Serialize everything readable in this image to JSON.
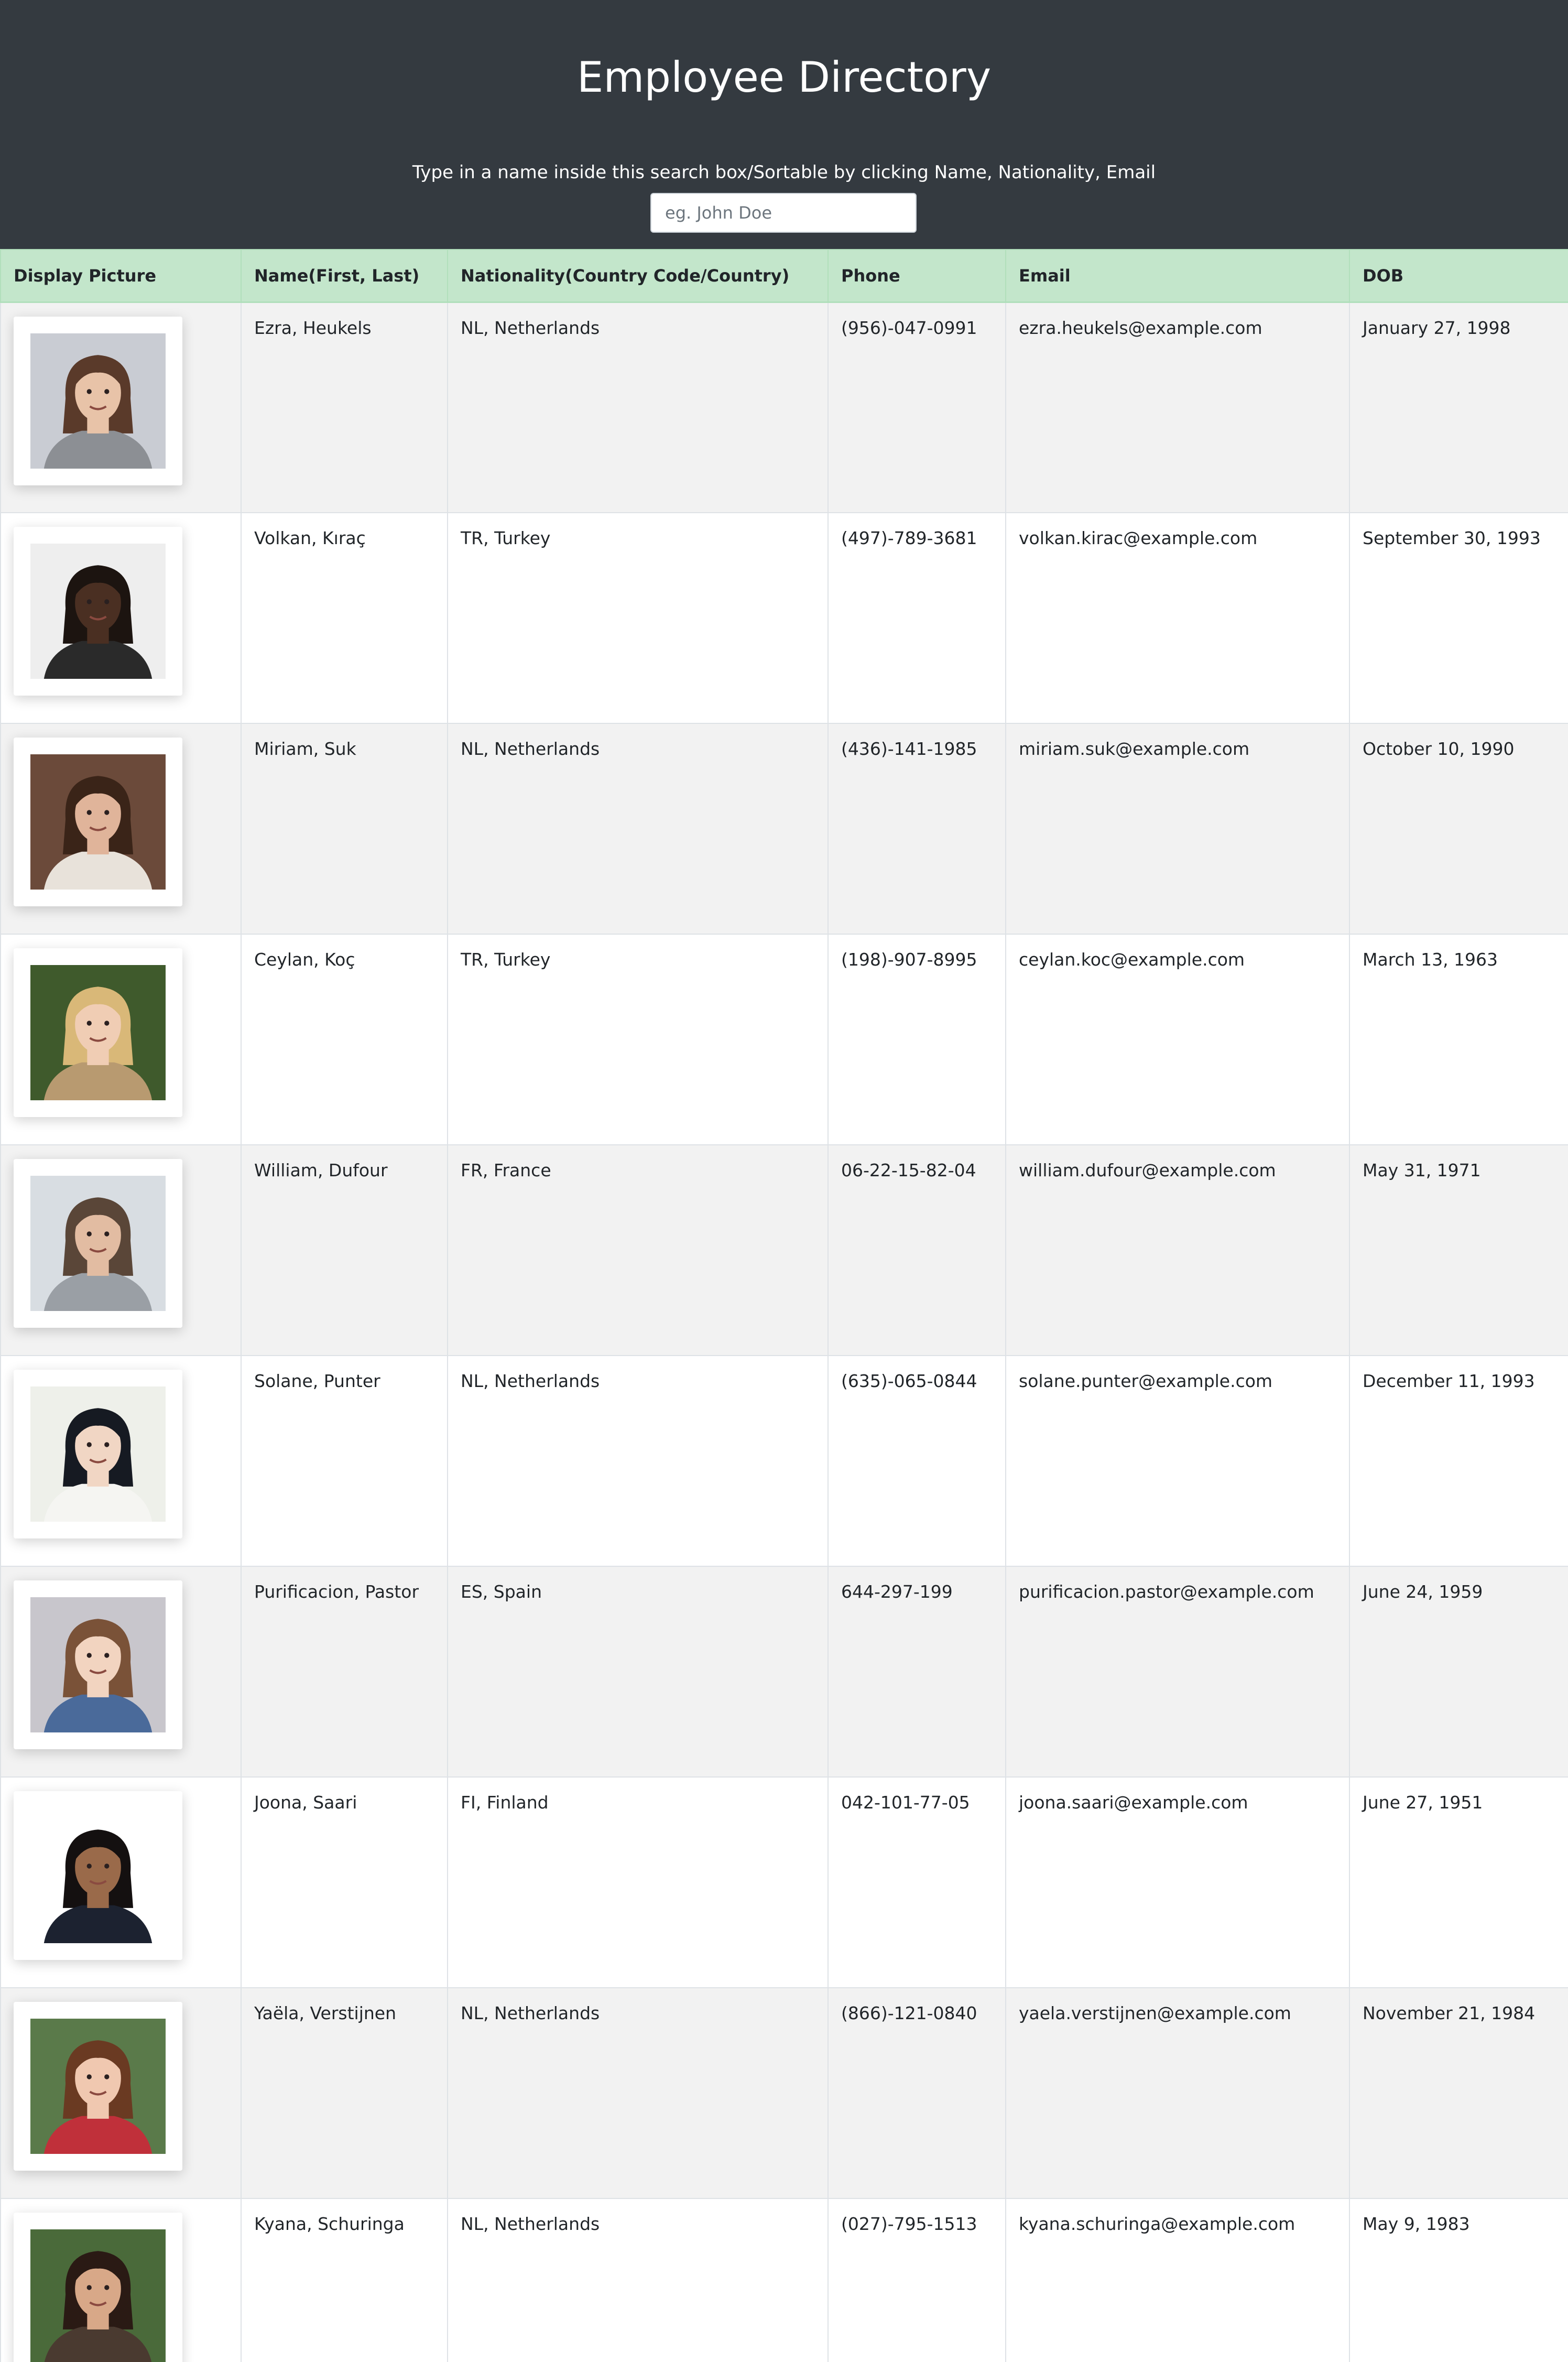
{
  "header": {
    "title": "Employee Directory",
    "hint": "Type in a name inside this search box/Sortable by clicking Name, Nationality, Email",
    "search_placeholder": "eg. John Doe"
  },
  "table": {
    "columns": [
      "Display Picture",
      "Name(First, Last)",
      "Nationality(Country Code/Country)",
      "Phone",
      "Email",
      "DOB"
    ],
    "rows": [
      {
        "name": "Ezra, Heukels",
        "nationality": "NL, Netherlands",
        "phone": "(956)-047-0991",
        "email": "ezra.heukels@example.com",
        "dob": "January 27, 1998",
        "photo": {
          "bg": "#c9ccd3",
          "skin": "#e8c3a8",
          "hair": "#5a3a2a",
          "shirt": "#8c8f94"
        }
      },
      {
        "name": "Volkan, Kıraç",
        "nationality": "TR, Turkey",
        "phone": "(497)-789-3681",
        "email": "volkan.kirac@example.com",
        "dob": "September 30, 1993",
        "photo": {
          "bg": "#eeeeee",
          "skin": "#4a2f22",
          "hair": "#1c1410",
          "shirt": "#2a2a2a"
        }
      },
      {
        "name": "Miriam, Suk",
        "nationality": "NL, Netherlands",
        "phone": "(436)-141-1985",
        "email": "miriam.suk@example.com",
        "dob": "October 10, 1990",
        "photo": {
          "bg": "#6b4a3a",
          "skin": "#e0b49a",
          "hair": "#3a2418",
          "shirt": "#e8e2da"
        }
      },
      {
        "name": "Ceylan, Koç",
        "nationality": "TR, Turkey",
        "phone": "(198)-907-8995",
        "email": "ceylan.koc@example.com",
        "dob": "March 13, 1963",
        "photo": {
          "bg": "#3f5a2c",
          "skin": "#f0cdb4",
          "hair": "#d9b878",
          "shirt": "#b89a70"
        }
      },
      {
        "name": "William, Dufour",
        "nationality": "FR, France",
        "phone": "06-22-15-82-04",
        "email": "william.dufour@example.com",
        "dob": "May 31, 1971",
        "photo": {
          "bg": "#d8dde2",
          "skin": "#e2bca2",
          "hair": "#5a4638",
          "shirt": "#9a9fa5"
        }
      },
      {
        "name": "Solane, Punter",
        "nationality": "NL, Netherlands",
        "phone": "(635)-065-0844",
        "email": "solane.punter@example.com",
        "dob": "December 11, 1993",
        "photo": {
          "bg": "#eef0ea",
          "skin": "#f1d6c4",
          "hair": "#161a22",
          "shirt": "#f5f5f2"
        }
      },
      {
        "name": "Purificacion, Pastor",
        "nationality": "ES, Spain",
        "phone": "644-297-199",
        "email": "purificacion.pastor@example.com",
        "dob": "June 24, 1959",
        "photo": {
          "bg": "#c8c6cc",
          "skin": "#f2d4c0",
          "hair": "#7a5238",
          "shirt": "#4a6a9a"
        }
      },
      {
        "name": "Joona, Saari",
        "nationality": "FI, Finland",
        "phone": "042-101-77-05",
        "email": "joona.saari@example.com",
        "dob": "June 27, 1951",
        "photo": {
          "bg": "#ffffff",
          "skin": "#9a6a4a",
          "hair": "#141010",
          "shirt": "#1c2230"
        }
      },
      {
        "name": "Yaëla, Verstijnen",
        "nationality": "NL, Netherlands",
        "phone": "(866)-121-0840",
        "email": "yaela.verstijnen@example.com",
        "dob": "November 21, 1984",
        "photo": {
          "bg": "#5a7a4a",
          "skin": "#f0c8b0",
          "hair": "#6a3a22",
          "shirt": "#c0303a"
        }
      },
      {
        "name": "Kyana, Schuringa",
        "nationality": "NL, Netherlands",
        "phone": "(027)-795-1513",
        "email": "kyana.schuringa@example.com",
        "dob": "May 9, 1983",
        "photo": {
          "bg": "#4a6a3a",
          "skin": "#d8a888",
          "hair": "#2a1a14",
          "shirt": "#4a3a30"
        }
      }
    ]
  }
}
